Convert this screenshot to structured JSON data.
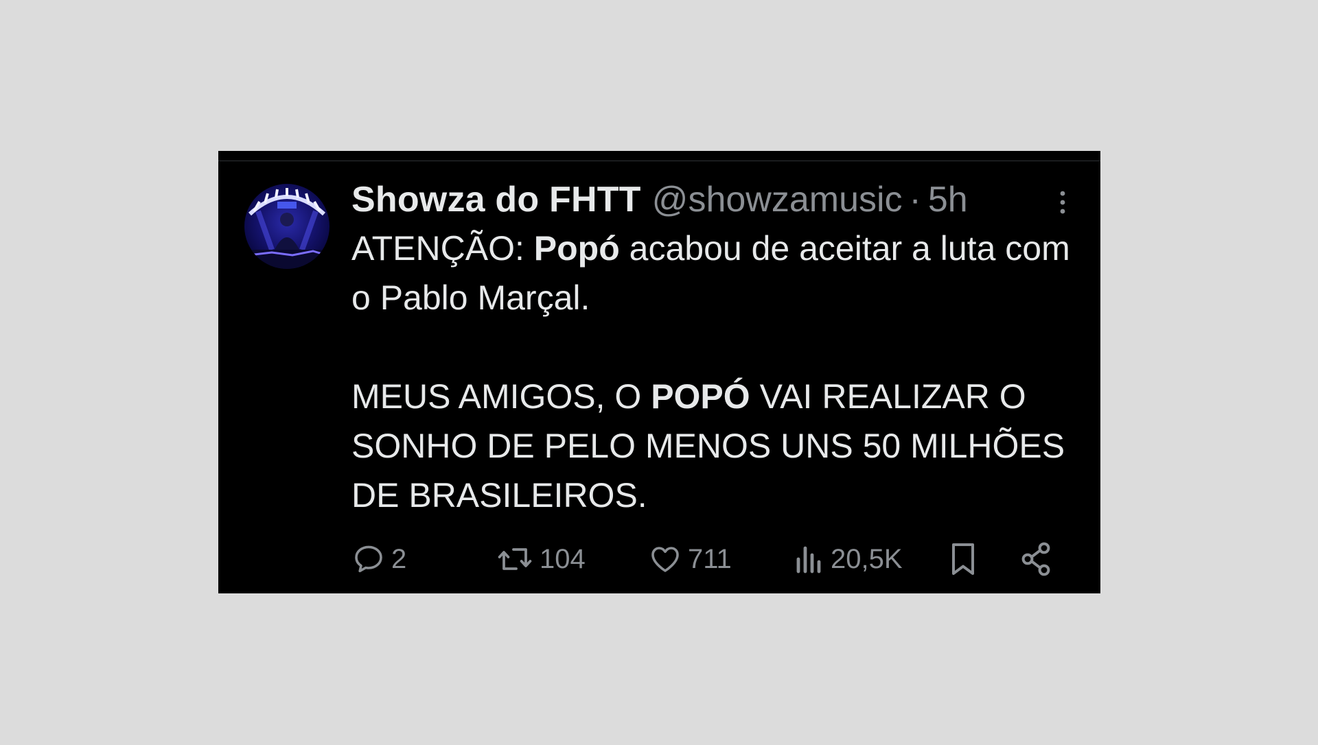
{
  "tweet": {
    "display_name": "Showza do FHTT",
    "handle": "@showzamusic",
    "separator": "·",
    "time": "5h",
    "paragraph1": {
      "prefix": "ATENÇÃO: ",
      "bold": "Popó",
      "suffix": " acabou de aceitar a luta com o Pablo Marçal."
    },
    "paragraph2": {
      "prefix": "MEUS AMIGOS, O ",
      "bold": "POPÓ",
      "suffix": " VAI REALIZAR O SONHO DE PELO MENOS UNS 50 MILHÕES DE BRASILEIROS."
    },
    "actions": {
      "replies": "2",
      "retweets": "104",
      "likes": "711",
      "views": "20,5K"
    }
  },
  "icons": {
    "avatar": "avatar-image",
    "more": "more-options-icon",
    "reply": "reply-icon",
    "retweet": "retweet-icon",
    "like": "heart-icon",
    "views": "views-chart-icon",
    "bookmark": "bookmark-icon",
    "share": "share-icon"
  },
  "colors": {
    "background": "#dcdcdc",
    "card": "#000000",
    "text_primary": "#e7e9ea",
    "text_secondary": "#8b8f94"
  }
}
